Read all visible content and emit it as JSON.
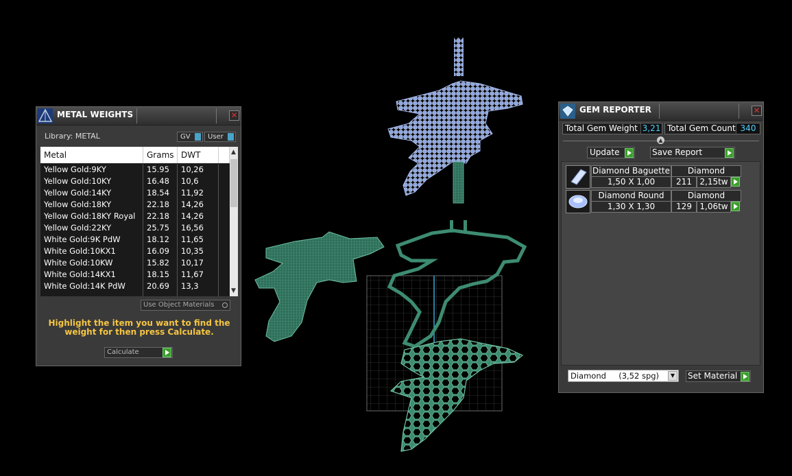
{
  "metal_weights": {
    "title": "METAL WEIGHTS",
    "library_label": "Library: METAL",
    "toggle_gv": "GV",
    "toggle_user": "User",
    "columns": [
      "Metal",
      "Grams",
      "DWT"
    ],
    "rows": [
      {
        "metal": "Yellow Gold:9KY",
        "grams": "15.95",
        "dwt": "10,26"
      },
      {
        "metal": "Yellow Gold:10KY",
        "grams": "16.48",
        "dwt": "10,6"
      },
      {
        "metal": "Yellow Gold:14KY",
        "grams": "18.54",
        "dwt": "11,92"
      },
      {
        "metal": "Yellow Gold:18KY",
        "grams": "22.18",
        "dwt": "14,26"
      },
      {
        "metal": "Yellow Gold:18KY Royal",
        "grams": "22.18",
        "dwt": "14,26"
      },
      {
        "metal": "Yellow Gold:22KY",
        "grams": "25.75",
        "dwt": "16,56"
      },
      {
        "metal": "White Gold:9K PdW",
        "grams": "18.12",
        "dwt": "11,65"
      },
      {
        "metal": "White Gold:10KX1",
        "grams": "16.09",
        "dwt": "10,35"
      },
      {
        "metal": "White Gold:10KW",
        "grams": "15.82",
        "dwt": "10,17"
      },
      {
        "metal": "White Gold:14KX1",
        "grams": "18.15",
        "dwt": "11,67"
      },
      {
        "metal": "White Gold:14K PdW",
        "grams": "20.69",
        "dwt": "13,3"
      }
    ],
    "use_object_materials": "Use Object Materials",
    "instruction": "Highlight the item you want to find the weight for then press Calculate.",
    "calculate_label": "Calculate"
  },
  "gem_reporter": {
    "title": "GEM REPORTER",
    "total_weight_label": "Total Gem Weight",
    "total_weight_value": "3,21",
    "total_count_label": "Total Gem Count",
    "total_count_value": "340",
    "update_label": "Update",
    "save_report_label": "Save Report",
    "gems": [
      {
        "name": "Diamond Baguette",
        "material": "Diamond",
        "size": "1,50 X 1,00",
        "count": "211",
        "weight": "2,15tw",
        "icon": "baguette-gem-icon"
      },
      {
        "name": "Diamond Round",
        "material": "Diamond",
        "size": "1,30 X 1,30",
        "count": "129",
        "weight": "1,06tw",
        "icon": "round-gem-icon"
      }
    ],
    "material_select": "Diamond     (3,52 spg)",
    "set_material_label": "Set Material"
  },
  "colors": {
    "gem_blue": "#8fa8e0",
    "metal_green": "#3d8c72",
    "accent_yellow": "#f5c542",
    "value_cyan": "#4fd0ff"
  }
}
